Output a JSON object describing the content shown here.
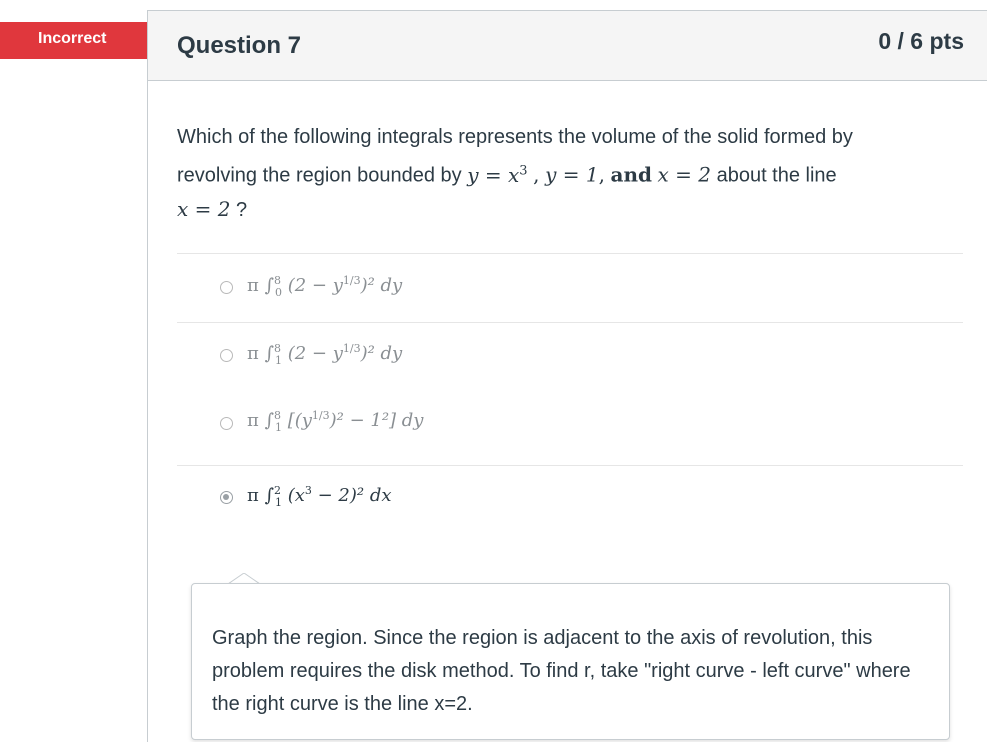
{
  "status_flag": {
    "label": "Incorrect",
    "color": "#e0373d"
  },
  "question": {
    "title": "Question 7",
    "points": "0 / 6 pts",
    "text_intro": "Which of the following integrals represents the volume of the solid formed by revolving the region bounded by",
    "eq1_lhs": "y",
    "eq1_rhs": "x",
    "eq1_exp": "3",
    "eq2": "y = 1",
    "and_word": "and",
    "eq3": "x = 2",
    "about": "about the line",
    "line_eq": "x = 2",
    "qmark": "?"
  },
  "answers": [
    {
      "selected": false,
      "lower": "0",
      "upper": "8",
      "body": "(2 − y",
      "exp": "1/3",
      "tail": ")² dy"
    },
    {
      "selected": false,
      "lower": "1",
      "upper": "8",
      "body": "(2 − y",
      "exp": "1/3",
      "tail": ")² dy"
    },
    {
      "selected": false,
      "lower": "1",
      "upper": "8",
      "body": "[(y",
      "exp": "1/3",
      "tail": ")² − 1²] dy"
    },
    {
      "selected": true,
      "lower": "1",
      "upper": "2",
      "body": "(x",
      "exp": "3",
      "tail": " − 2)² dx"
    }
  ],
  "comment": {
    "text": "Graph the region. Since the region is adjacent to the axis of revolution, this problem requires the disk method. To find r, take \"right curve - left curve\" where the right curve is the line x=2."
  }
}
